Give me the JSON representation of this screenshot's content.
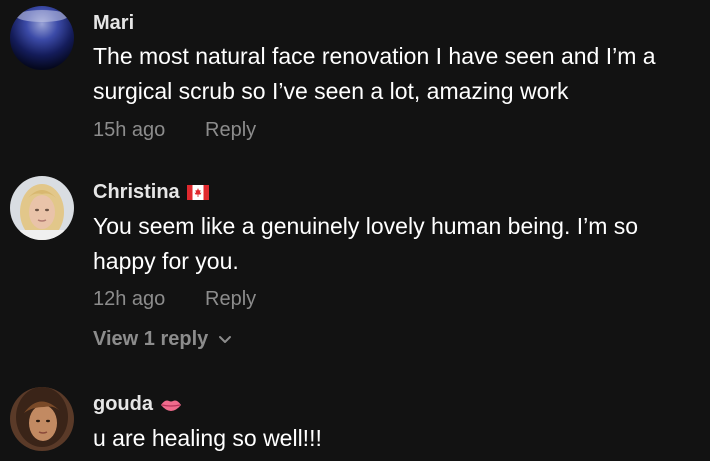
{
  "comments": [
    {
      "username": "Mari",
      "badge_icon": "",
      "text": "The most natural face renovation I have seen and I’m a surgical scrub so I’ve seen a lot, amazing work",
      "time": "15h ago",
      "reply_label": "Reply",
      "avatar_icon": "dark-blue-sphere-avatar"
    },
    {
      "username": "Christina",
      "badge_icon": "canada-flag-icon",
      "text": "You seem like a genuinely lovely human being. I’m so happy for you.",
      "time": "12h ago",
      "reply_label": "Reply",
      "avatar_icon": "blonde-woman-photo-avatar",
      "view_replies_label": "View 1 reply"
    },
    {
      "username": "gouda",
      "badge_icon": "lips-emoji-icon",
      "text": "u are healing so well!!!",
      "avatar_icon": "woman-photo-avatar"
    }
  ],
  "colors": {
    "background": "#121212",
    "username": "#e6e6e6",
    "text": "#ffffff",
    "muted": "#8c8c8c"
  }
}
